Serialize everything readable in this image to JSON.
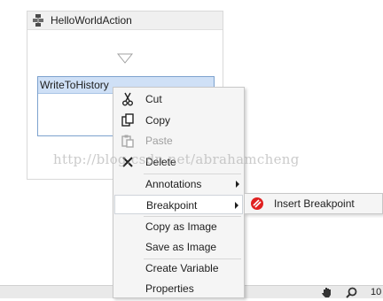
{
  "sequence": {
    "title": "HelloWorldAction",
    "icon": "sequence-icon"
  },
  "activity": {
    "title": "WriteToHistory"
  },
  "context_menu": {
    "items": [
      {
        "label": "Cut",
        "icon": "scissors-icon",
        "enabled": true
      },
      {
        "label": "Copy",
        "icon": "copy-icon",
        "enabled": true
      },
      {
        "label": "Paste",
        "icon": "paste-icon",
        "enabled": false
      },
      {
        "label": "Delete",
        "icon": "delete-x-icon",
        "enabled": true
      },
      {
        "label": "Annotations",
        "submenu": true
      },
      {
        "label": "Breakpoint",
        "submenu": true,
        "highlighted": true
      },
      {
        "label": "Copy as Image"
      },
      {
        "label": "Save as Image"
      },
      {
        "label": "Create Variable"
      },
      {
        "label": "Properties"
      }
    ]
  },
  "submenu": {
    "items": [
      {
        "label": "Insert Breakpoint",
        "icon": "breakpoint-icon"
      }
    ]
  },
  "watermark": "http://blog.csdn.net/abrahamcheng",
  "status_bar": {
    "zoom_text": "10"
  },
  "colors": {
    "activity_header": "#cfe0f6",
    "activity_border": "#7da2ce",
    "breakpoint_red": "#e02020",
    "menu_background": "#f5f5f5"
  }
}
